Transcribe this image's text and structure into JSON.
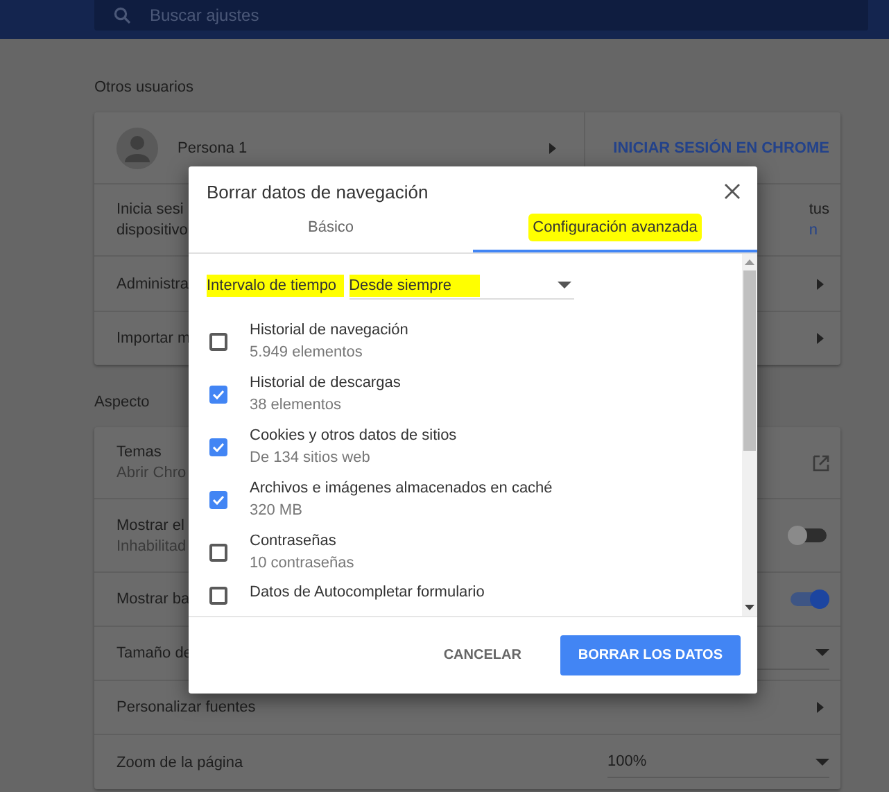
{
  "top_bar": {
    "search": {
      "placeholder": "Buscar ajustes"
    }
  },
  "sections": [
    {
      "title": "Otros usuarios",
      "rows": [
        {
          "kind": "person",
          "label": "Persona 1",
          "link": "INICIAR SESIÓN EN CHROME"
        },
        {
          "kind": "split",
          "label": "Inicia sesi",
          "sublabel": "dispositivo",
          "right_text": "tus",
          "right_link": "n"
        },
        {
          "kind": "arrow",
          "label": "Administra"
        },
        {
          "kind": "arrow",
          "label": "Importar m"
        }
      ]
    },
    {
      "title": "Aspecto",
      "rows": [
        {
          "kind": "external",
          "label": "Temas",
          "sublabel": "Abrir Chro"
        },
        {
          "kind": "toggle",
          "label": "Mostrar el",
          "sublabel": "Inhabilitad",
          "on": false
        },
        {
          "kind": "toggle",
          "label": "Mostrar ba",
          "on": true
        },
        {
          "kind": "dropdown",
          "label": "Tamaño de"
        },
        {
          "kind": "arrow",
          "label": "Personalizar fuentes"
        },
        {
          "kind": "dropdown",
          "label": "Zoom de la página",
          "value": "100%"
        }
      ]
    }
  ],
  "dialog": {
    "title": "Borrar datos de navegación",
    "tabs": [
      {
        "label": "Básico",
        "selected": false,
        "highlighted": false
      },
      {
        "label": "Configuración avanzada",
        "selected": true,
        "highlighted": true
      }
    ],
    "time_range": {
      "label": "Intervalo de tiempo",
      "value": "Desde siempre",
      "highlighted": true
    },
    "items": [
      {
        "title": "Historial de navegación",
        "detail": "5.949 elementos",
        "checked": false
      },
      {
        "title": "Historial de descargas",
        "detail": "38 elementos",
        "checked": true
      },
      {
        "title": "Cookies y otros datos de sitios",
        "detail": "De 134 sitios web",
        "checked": true
      },
      {
        "title": "Archivos e imágenes almacenados en caché",
        "detail": "320 MB",
        "checked": true
      },
      {
        "title": "Contraseñas",
        "detail": "10 contraseñas",
        "checked": false
      },
      {
        "title": "Datos de Autocompletar formulario",
        "checked": false
      }
    ],
    "buttons": {
      "cancel": "CANCELAR",
      "confirm": "BORRAR LOS DATOS"
    }
  }
}
